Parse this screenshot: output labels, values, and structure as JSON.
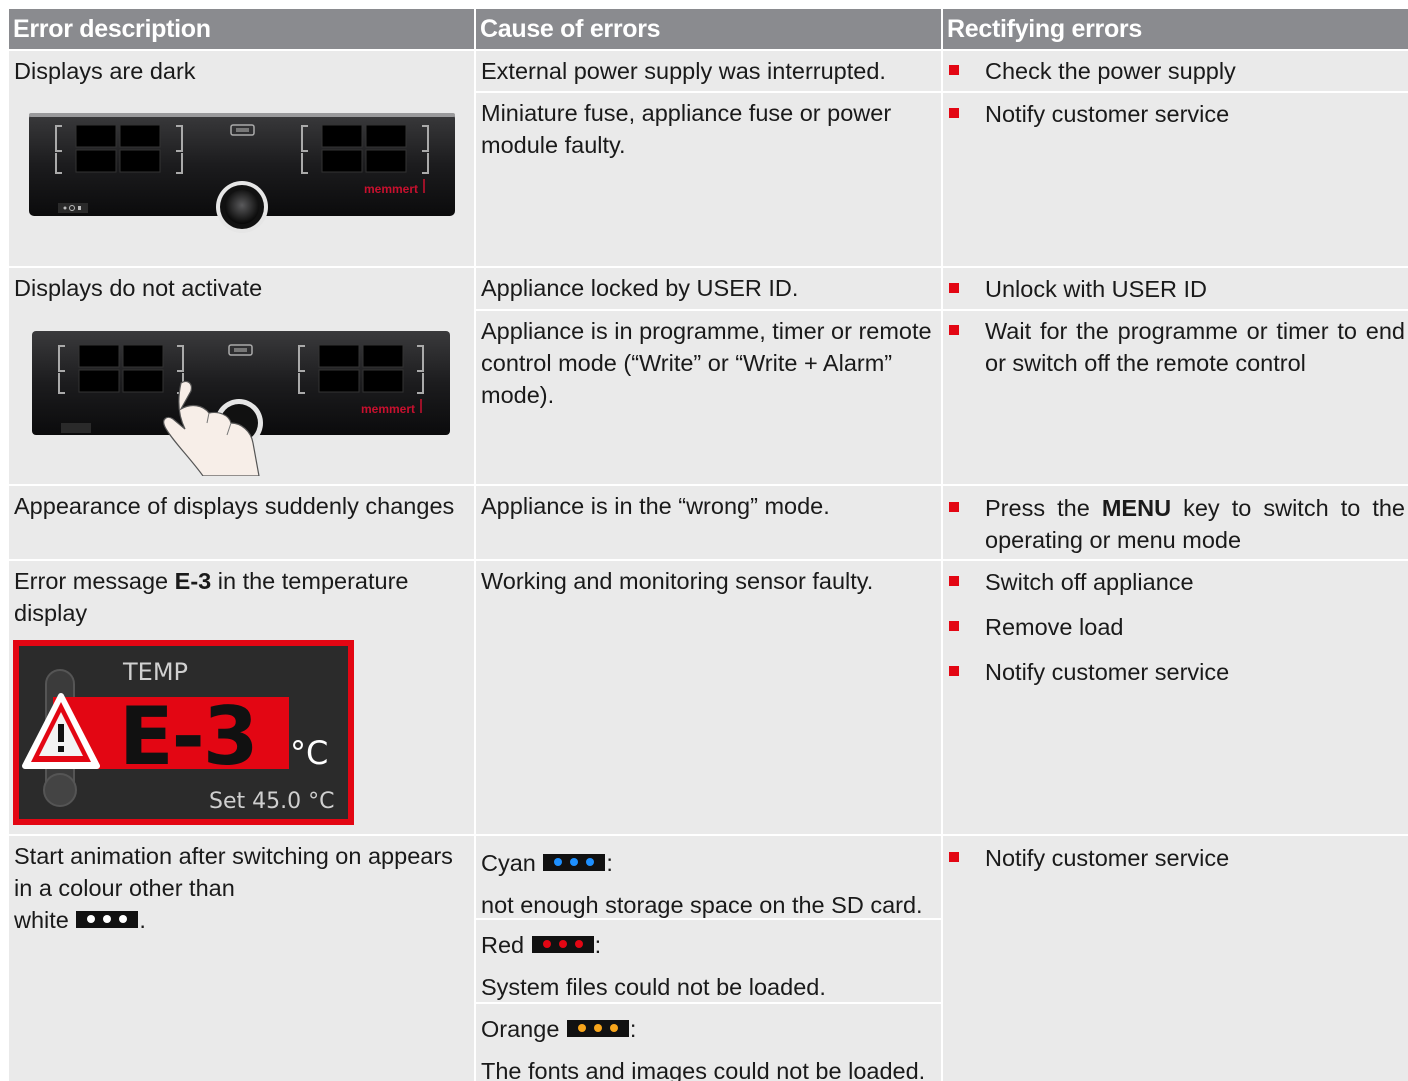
{
  "headers": [
    "Error description",
    "Cause of errors",
    "Rectifying errors"
  ],
  "row1": {
    "error": "Displays are dark",
    "causes": [
      "External power supply was interrupted.",
      "Miniature fuse, appliance fuse or power module faulty."
    ],
    "fixes": [
      "Check the power supply",
      "Notify customer service"
    ],
    "brand": "memmert"
  },
  "row2": {
    "error": "Displays do not activate",
    "causes": [
      "Appliance locked by USER ID.",
      "Appliance is in programme, timer or remote control mode (“Write” or “Write + Alarm” mode)."
    ],
    "fixes": [
      "Unlock with USER ID",
      "Wait for the programme or timer to end or switch off the remote control"
    ],
    "brand": "memmert"
  },
  "row3": {
    "error": "Appearance of displays suddenly changes",
    "cause": "Appliance is in the “wrong” mode.",
    "fix_pre": "Press the ",
    "fix_key": "MENU",
    "fix_post": " key to switch to the operating or menu mode"
  },
  "row4": {
    "error_pre": "Error message ",
    "error_code": "E-3",
    "error_post": " in the temperature display",
    "cause": "Working and monitoring sensor faulty.",
    "fixes": [
      "Switch off appliance",
      "Remove load",
      "Notify customer service"
    ],
    "display": {
      "label": "TEMP",
      "code": "E-3",
      "unit": "°C",
      "set": "Set 45.0 °C",
      "alert_icon": "warning-triangle-icon",
      "frame_color": "#e30613"
    }
  },
  "row5": {
    "error_pre": "Start animation after switching on appears in a colour other than",
    "error_white": "white",
    "error_end": ".",
    "causes": [
      {
        "name": "Cyan",
        "text": "not enough storage space on the SD card.",
        "color": "#1e90ff"
      },
      {
        "name": "Red",
        "text": "System files could not be loaded.",
        "color": "#e30613"
      },
      {
        "name": "Orange",
        "text": "The fonts and images could not be loaded.",
        "color": "#f7a51c"
      }
    ],
    "white_color": "#ffffff",
    "fix": "Notify customer service"
  }
}
